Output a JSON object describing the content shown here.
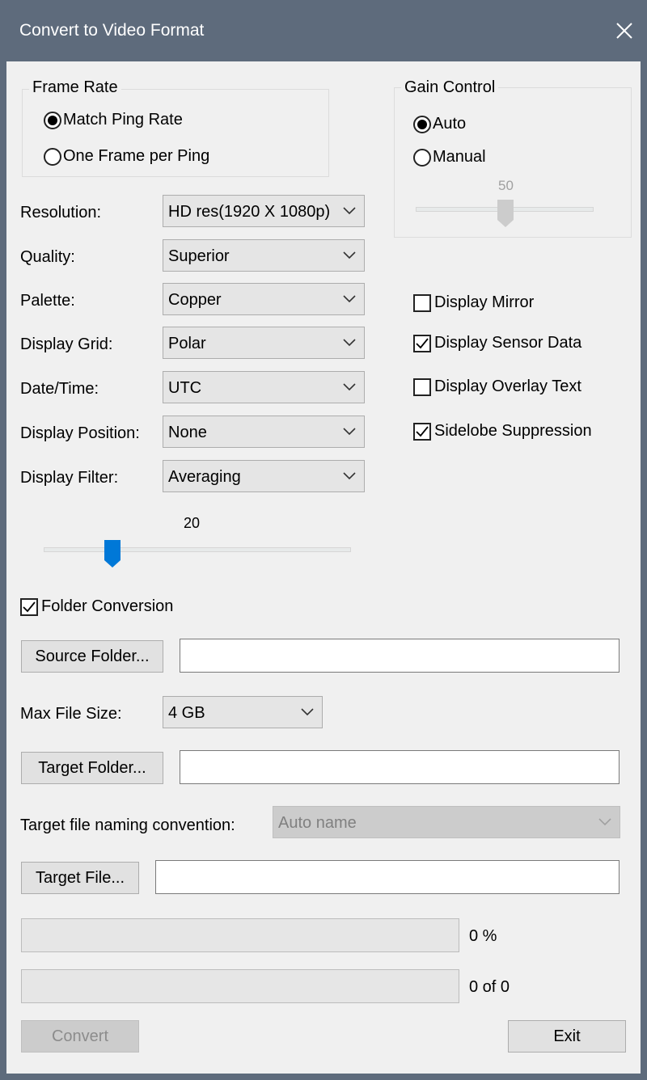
{
  "window": {
    "title": "Convert to Video Format"
  },
  "frame_rate": {
    "title": "Frame Rate",
    "options": [
      "Match Ping Rate",
      "One Frame per Ping"
    ],
    "selected": 0
  },
  "gain_control": {
    "title": "Gain Control",
    "auto_label": "Auto",
    "manual_label": "Manual",
    "auto_selected": true,
    "slider_value": "50",
    "slider_fraction": 0.5
  },
  "settings": {
    "resolution": {
      "label": "Resolution:",
      "value": "HD res(1920 X 1080p)"
    },
    "quality": {
      "label": "Quality:",
      "value": "Superior"
    },
    "palette": {
      "label": "Palette:",
      "value": "Copper"
    },
    "display_grid": {
      "label": "Display Grid:",
      "value": "Polar"
    },
    "date_time": {
      "label": "Date/Time:",
      "value": "UTC"
    },
    "display_position": {
      "label": "Display Position:",
      "value": "None"
    },
    "display_filter": {
      "label": "Display Filter:",
      "value": "Averaging"
    }
  },
  "filter_slider": {
    "value": "20",
    "fraction": 0.2
  },
  "options": {
    "display_mirror": {
      "label": "Display Mirror",
      "checked": false
    },
    "display_sensor_data": {
      "label": "Display Sensor Data",
      "checked": true
    },
    "display_overlay_text": {
      "label": "Display Overlay Text",
      "checked": false
    },
    "sidelobe_suppression": {
      "label": "Sidelobe Suppression",
      "checked": true
    }
  },
  "folder_conversion": {
    "label": "Folder Conversion",
    "checked": true
  },
  "source_folder": {
    "button": "Source Folder...",
    "value": ""
  },
  "max_file_size": {
    "label": "Max File Size:",
    "value": "4 GB"
  },
  "target_folder": {
    "button": "Target Folder...",
    "value": ""
  },
  "naming": {
    "label": "Target file naming convention:",
    "value": "Auto name"
  },
  "target_file": {
    "button": "Target File...",
    "value": ""
  },
  "progress": {
    "overall_text": "0 %",
    "overall_fraction": 0,
    "count_text": "0 of 0",
    "count_fraction": 0
  },
  "actions": {
    "convert": "Convert",
    "exit": "Exit"
  },
  "colors": {
    "titlebar": "#5e6b7c",
    "slider_thumb_active": "#0078d7",
    "slider_thumb_disabled": "#cccccc"
  }
}
